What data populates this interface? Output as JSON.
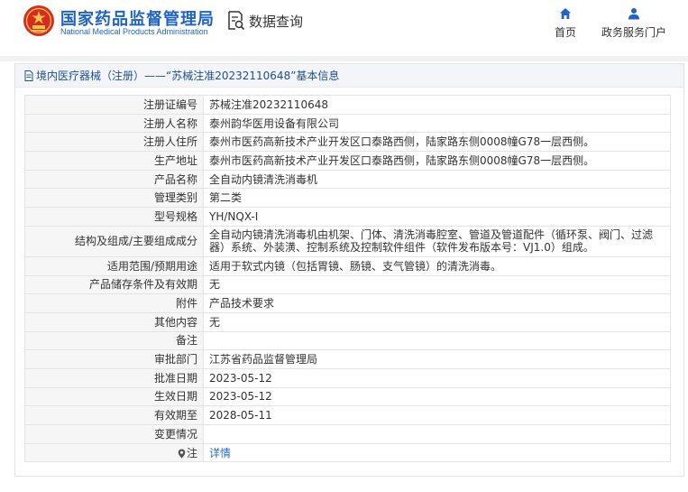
{
  "header": {
    "brand_cn": "国家药品监督管理局",
    "brand_en": "National Medical Products Administration",
    "query_label": "数据查询",
    "nav": [
      {
        "label": "首页",
        "icon": "home-icon"
      },
      {
        "label": "政务服务门户",
        "icon": "user-icon"
      }
    ]
  },
  "panel": {
    "title": "境内医疗器械（注册）——“苏械注准20232110648”基本信息"
  },
  "rows": [
    {
      "label": "注册证编号",
      "value": "苏械注准20232110648"
    },
    {
      "label": "注册人名称",
      "value": "泰州韵华医用设备有限公司"
    },
    {
      "label": "注册人住所",
      "value": "泰州市医药高新技术产业开发区口泰路西侧，陆家路东侧0008幢G78一层西侧。"
    },
    {
      "label": "生产地址",
      "value": "泰州市医药高新技术产业开发区口泰路西侧，陆家路东侧0008幢G78一层西侧。"
    },
    {
      "label": "产品名称",
      "value": "全自动内镜清洗消毒机"
    },
    {
      "label": "管理类别",
      "value": "第二类"
    },
    {
      "label": "型号规格",
      "value": "YH/NQX-I"
    },
    {
      "label": "结构及组成/主要组成成分",
      "value": "全自动内镜清洗消毒机由机架、门体、清洗消毒腔室、管道及管道配件（循环泵、阀门、过滤器）系统、外装潢、控制系统及控制软件组件（软件发布版本号：VJ1.0）组成。"
    },
    {
      "label": "适用范围/预期用途",
      "value": "适用于软式内镜（包括胃镜、肠镜、支气管镜）的清洗消毒。"
    },
    {
      "label": "产品储存条件及有效期",
      "value": "无"
    },
    {
      "label": "附件",
      "value": "产品技术要求"
    },
    {
      "label": "其他内容",
      "value": "无"
    },
    {
      "label": "备注",
      "value": ""
    },
    {
      "label": "审批部门",
      "value": "江苏省药品监督管理局"
    },
    {
      "label": "批准日期",
      "value": "2023-05-12"
    },
    {
      "label": "生效日期",
      "value": "2023-05-12"
    },
    {
      "label": "有效期至",
      "value": "2028-05-11"
    },
    {
      "label": "变更情况",
      "value": ""
    }
  ],
  "note": {
    "label": "注",
    "link": "详情"
  },
  "colors": {
    "brand": "#1f63c9",
    "title_text": "#1f4f92",
    "link": "#2a6bcc",
    "label_bg": "#f6f6f6"
  }
}
